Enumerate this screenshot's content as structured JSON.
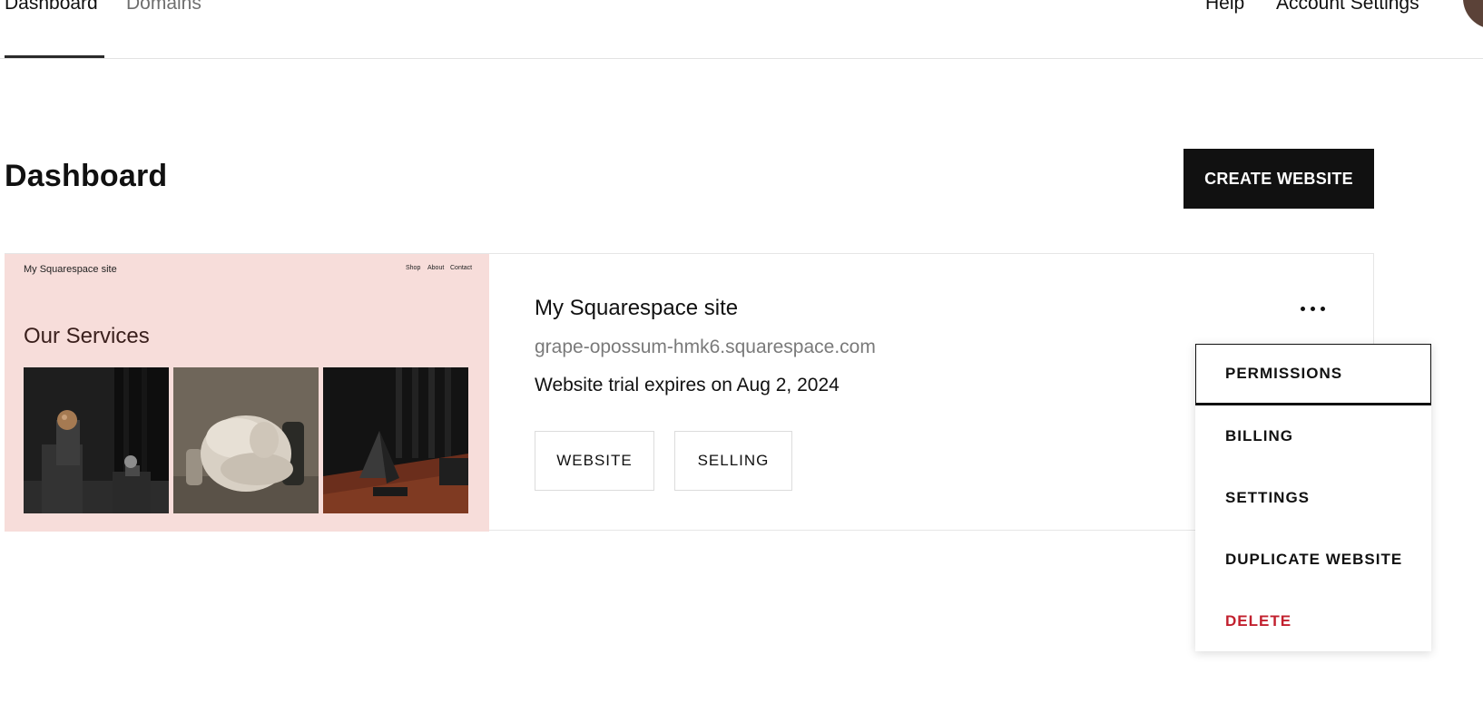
{
  "nav": {
    "tabs": [
      {
        "label": "Dashboard",
        "active": true
      },
      {
        "label": "Domains",
        "active": false
      }
    ],
    "help_label": "Help",
    "account_label": "Account Settings"
  },
  "header": {
    "title": "Dashboard",
    "create_label": "CREATE WEBSITE"
  },
  "site": {
    "name": "My Squarespace site",
    "url": "grape-opossum-hmk6.squarespace.com",
    "trial": "Website trial expires on Aug 2, 2024",
    "website_label": "WEBSITE",
    "selling_label": "SELLING",
    "thumbnail": {
      "title": "My Squarespace site",
      "nav": [
        "Shop",
        "About",
        "Contact"
      ],
      "heading": "Our Services"
    }
  },
  "menu": {
    "items": [
      "PERMISSIONS",
      "BILLING",
      "SETTINGS",
      "DUPLICATE WEBSITE",
      "DELETE"
    ]
  },
  "colors": {
    "primary": "#111111",
    "thumbnail_bg": "#f7ddda",
    "danger": "#c2202e",
    "muted": "#7a7a7a"
  }
}
